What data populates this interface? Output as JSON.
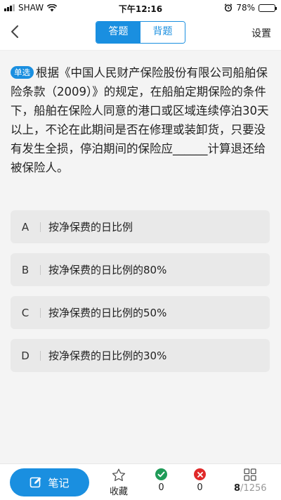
{
  "status_bar": {
    "carrier": "SHAW",
    "time": "下午12:16",
    "battery": "78%",
    "battery_level": 0.78
  },
  "nav": {
    "tabs": [
      {
        "label": "答题",
        "active": true
      },
      {
        "label": "背题",
        "active": false
      }
    ],
    "settings_label": "设置"
  },
  "question": {
    "type_tag": "单选",
    "text": "根据《中国人民财产保险股份有限公司船舶保险条款（2009）》的规定，在船舶定期保险的条件下，船舶在保险人同意的港口或区域连续停泊30天以上，不论在此期间是否在修理或装卸货，只要没有发生全损，停泊期间的保险应______计算退还给被保险人。"
  },
  "options": [
    {
      "letter": "A",
      "text": "按净保费的日比例"
    },
    {
      "letter": "B",
      "text": "按净保费的日比例的80%"
    },
    {
      "letter": "C",
      "text": "按净保费的日比例的50%"
    },
    {
      "letter": "D",
      "text": "按净保费的日比例的30%"
    }
  ],
  "bottom": {
    "note_label": "笔记",
    "favorite_label": "收藏",
    "correct_count": "0",
    "wrong_count": "0",
    "current": "8",
    "total": "/1256"
  },
  "colors": {
    "accent": "#1a8fe0",
    "correct": "#1f9b58",
    "wrong": "#e02a2a"
  }
}
